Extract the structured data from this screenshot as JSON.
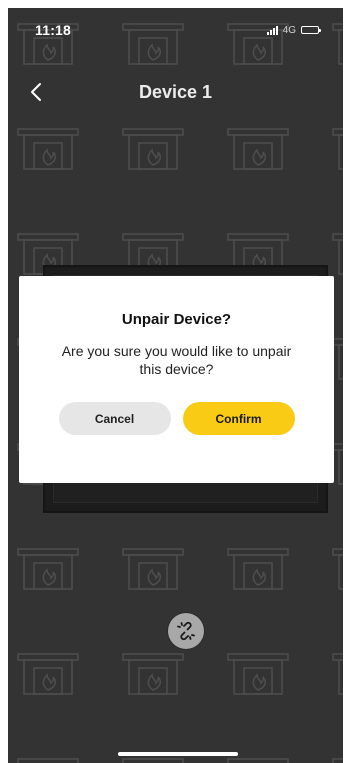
{
  "status_bar": {
    "time": "11:18",
    "network": "4G"
  },
  "header": {
    "title": "Device 1",
    "back_icon": "chevron-left-icon"
  },
  "dialog": {
    "title": "Unpair Device?",
    "message": "Are you sure you would like to unpair this device?",
    "cancel_label": "Cancel",
    "confirm_label": "Confirm"
  },
  "actions": {
    "unlink_icon": "unlink-icon"
  },
  "colors": {
    "background": "#333333",
    "accent": "#f9cb15",
    "dialog_bg": "#ffffff",
    "cancel_bg": "#e6e6e6",
    "unlink_bg": "#a8a8a8"
  }
}
